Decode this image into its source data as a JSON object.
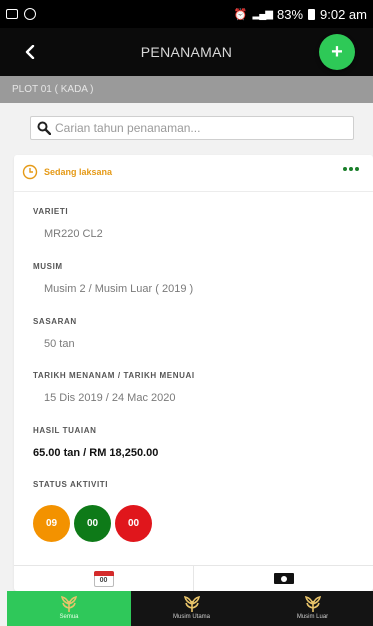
{
  "status_bar": {
    "battery": "83%",
    "time": "9:02 am"
  },
  "app_bar": {
    "title": "PENANAMAN",
    "add_label": "+"
  },
  "plot": {
    "label": "PLOT 01 ( KADA )"
  },
  "search": {
    "placeholder": "Carian tahun penanaman..."
  },
  "card": {
    "status": "Sedang laksana",
    "fields": [
      {
        "label": "VARIETI",
        "value": "MR220 CL2"
      },
      {
        "label": "MUSIM",
        "value": "Musim 2 / Musim Luar ( 2019 )"
      },
      {
        "label": "SASARAN",
        "value": "50 tan"
      },
      {
        "label": "TARIKH MENANAM / TARIKH MENUAI",
        "value": "15 Dis 2019 / 24 Mac 2020"
      },
      {
        "label": "HASIL TUAIAN",
        "value": "65.00 tan / RM 18,250.00"
      }
    ],
    "activity_label": "STATUS AKTIVITI",
    "activity": [
      {
        "count": "09",
        "color": "#f39200"
      },
      {
        "count": "00",
        "color": "#0e7a18"
      },
      {
        "count": "00",
        "color": "#e0161c"
      }
    ],
    "calendar_icon_text": "00"
  },
  "colors": {
    "accent_green": "#2ec957",
    "status_orange": "#e59a17"
  },
  "bottom_nav": [
    {
      "label": "Semua",
      "active": true
    },
    {
      "label": "Musim Utama",
      "active": false
    },
    {
      "label": "Musim Luar",
      "active": false
    }
  ]
}
